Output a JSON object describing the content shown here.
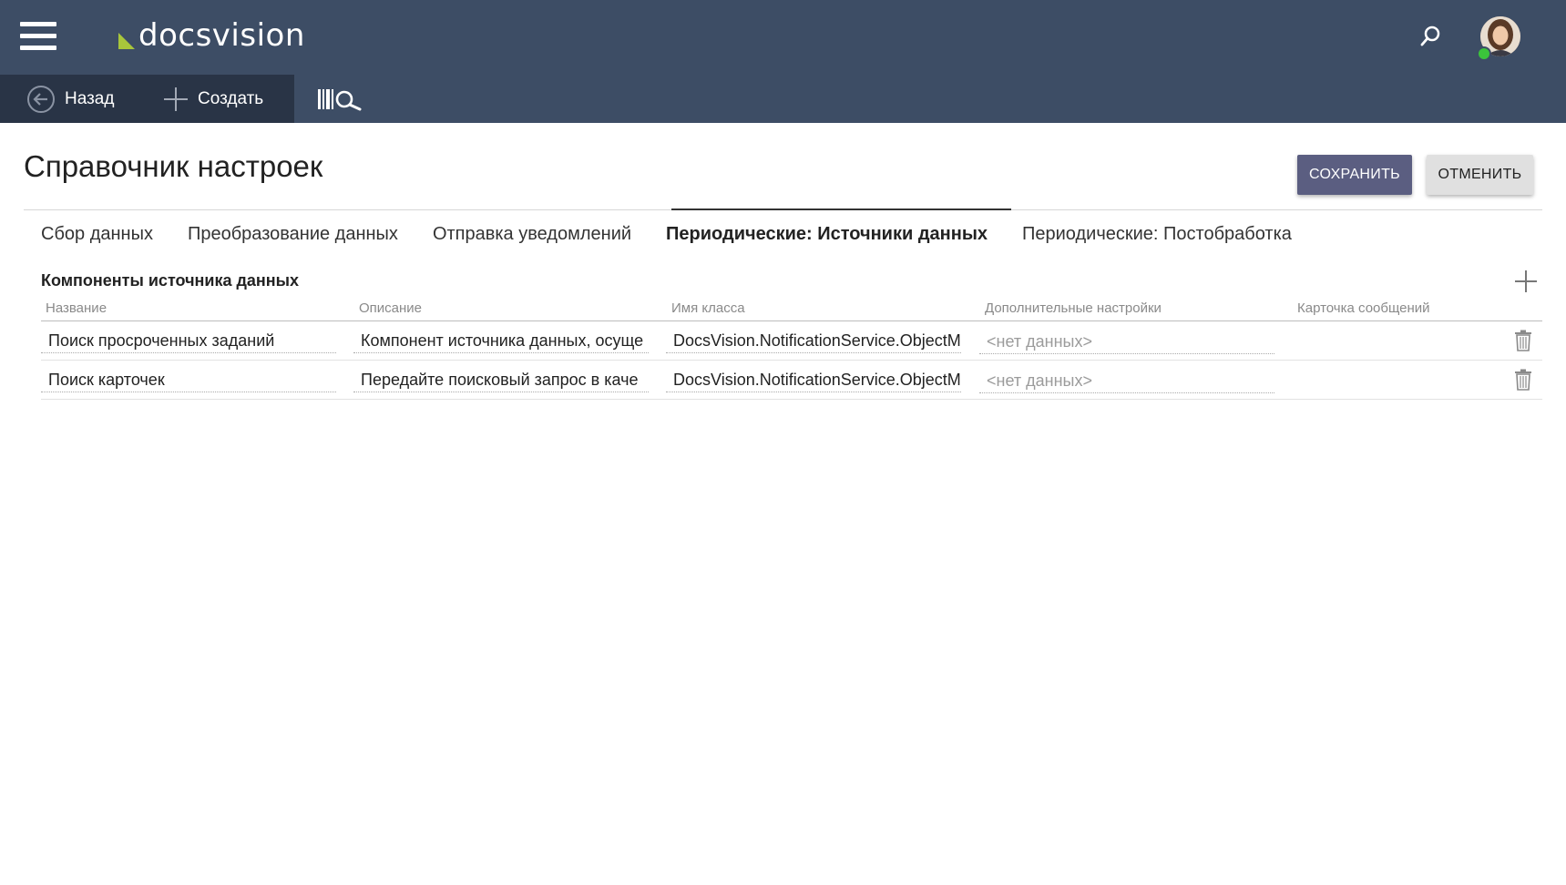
{
  "header": {
    "logo_text": "docsvision",
    "logo_mark_color": "#a8c63b",
    "bar_color": "#3d4d65"
  },
  "toolbar": {
    "back_label": "Назад",
    "create_label": "Создать"
  },
  "page": {
    "title": "Справочник настроек",
    "save_label": "СОХРАНИТЬ",
    "cancel_label": "ОТМЕНИТЬ"
  },
  "tabs": [
    {
      "label": "Сбор данных",
      "active": false
    },
    {
      "label": "Преобразование данных",
      "active": false
    },
    {
      "label": "Отправка уведомлений",
      "active": false
    },
    {
      "label": "Периодические: Источники данных",
      "active": true
    },
    {
      "label": "Периодические: Постобработка",
      "active": false
    }
  ],
  "section": {
    "title": "Компоненты источника данных"
  },
  "table": {
    "columns": [
      "Название",
      "Описание",
      "Имя класса",
      "Дополнительные настройки",
      "Карточка сообщений"
    ],
    "rows": [
      {
        "name": "Поиск просроченных заданий",
        "description": "Компонент источника данных, осуще",
        "class_name": "DocsVision.NotificationService.ObjectM",
        "settings": "<нет данных>",
        "card": ""
      },
      {
        "name": "Поиск карточек",
        "description": "Передайте поисковый запрос в каче",
        "class_name": "DocsVision.NotificationService.ObjectM",
        "settings": "<нет данных>",
        "card": ""
      }
    ]
  }
}
